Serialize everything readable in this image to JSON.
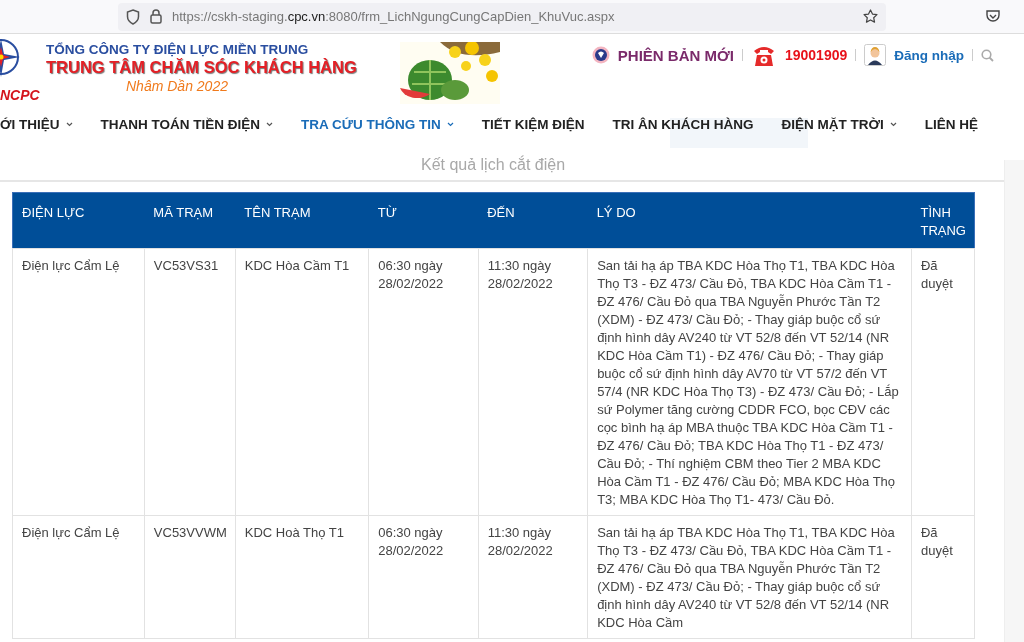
{
  "browser": {
    "url_prefix": "https://cskh-staging.",
    "url_domain": "cpc.vn",
    "url_suffix": ":8080/frm_LichNgungCungCapDien_KhuVuc.aspx"
  },
  "header": {
    "logo_text": "NCPC",
    "company": "TỔNG CÔNG TY ĐIỆN LỰC MIỀN TRUNG",
    "center": "TRUNG TÂM CHĂM SÓC KHÁCH HÀNG",
    "greeting": "Nhâm Dần 2022",
    "new_version": "PHIÊN BẢN MỚI",
    "hotline": "19001909",
    "login": "Đăng nhập"
  },
  "nav": [
    {
      "label": "ỚI THIỆU",
      "dropdown": true,
      "selected": false
    },
    {
      "label": "THANH TOÁN TIỀN ĐIỆN",
      "dropdown": true,
      "selected": false
    },
    {
      "label": "TRA CỨU THÔNG TIN",
      "dropdown": true,
      "selected": true
    },
    {
      "label": "TIẾT KIỆM ĐIỆN",
      "dropdown": false,
      "selected": false
    },
    {
      "label": "TRI ÂN KHÁCH HÀNG",
      "dropdown": false,
      "selected": false
    },
    {
      "label": "ĐIỆN MẶT TRỜI",
      "dropdown": true,
      "selected": false
    },
    {
      "label": "LIÊN HỆ",
      "dropdown": false,
      "selected": false
    }
  ],
  "results_title": "Kết quả lịch cắt điện",
  "table": {
    "columns": [
      "ĐIỆN LỰC",
      "MÃ TRẠM",
      "TÊN TRẠM",
      "TỪ",
      "ĐẾN",
      "LÝ DO",
      "TÌNH TRẠNG"
    ],
    "rows": [
      [
        "Điện lực Cẩm Lệ",
        "VC53VS31",
        "KDC Hòa Cầm T1",
        "06:30 ngày 28/02/2022",
        "11:30 ngày 28/02/2022",
        "San tải hạ áp TBA KDC Hòa Thọ T1, TBA KDC Hòa Thọ T3 - ĐZ 473/ Cầu Đỏ, TBA KDC Hòa Cầm T1 - ĐZ 476/ Cầu Đỏ qua TBA Nguyễn Phước Tần T2 (XDM) - ĐZ 473/ Cầu Đỏ; - Thay giáp buộc cổ sứ định hình dây AV240 từ VT 52/8 đến VT 52/14 (NR KDC Hòa Cầm T1) - ĐZ 476/ Cầu Đỏ; - Thay giáp buộc cổ sứ định hình dây AV70 từ VT 57/2 đến VT 57/4 (NR KDC Hòa Thọ T3) - ĐZ 473/ Cầu Đỏ; - Lắp sứ Polymer tăng cường CDDR FCO, bọc CĐV các cọc bình hạ áp MBA thuộc TBA KDC Hòa Cầm T1 - ĐZ 476/ Cầu Đỏ; TBA KDC Hòa Thọ T1 - ĐZ 473/ Cầu Đỏ; - Thí nghiệm CBM theo Tier 2 MBA KDC Hòa Cầm T1 - ĐZ 476/ Cầu Đỏ; MBA KDC Hòa Thọ T3; MBA KDC Hòa Thọ T1- 473/ Cầu Đỏ.",
        "Đã duyệt"
      ],
      [
        "Điện lực Cẩm Lệ",
        "VC53VVWM",
        "KDC Hoà Thọ T1",
        "06:30 ngày 28/02/2022",
        "11:30 ngày 28/02/2022",
        "San tải hạ áp TBA KDC Hòa Thọ T1, TBA KDC Hòa Thọ T3 - ĐZ 473/ Cầu Đỏ, TBA KDC Hòa Cầm T1 - ĐZ 476/ Cầu Đỏ qua TBA Nguyễn Phước Tần T2 (XDM) - ĐZ 473/ Cầu Đỏ; - Thay giáp buộc cổ sứ định hình dây AV240 từ VT 52/8 đến VT 52/14 (NR KDC Hòa Cầm",
        "Đã duyệt"
      ]
    ]
  }
}
